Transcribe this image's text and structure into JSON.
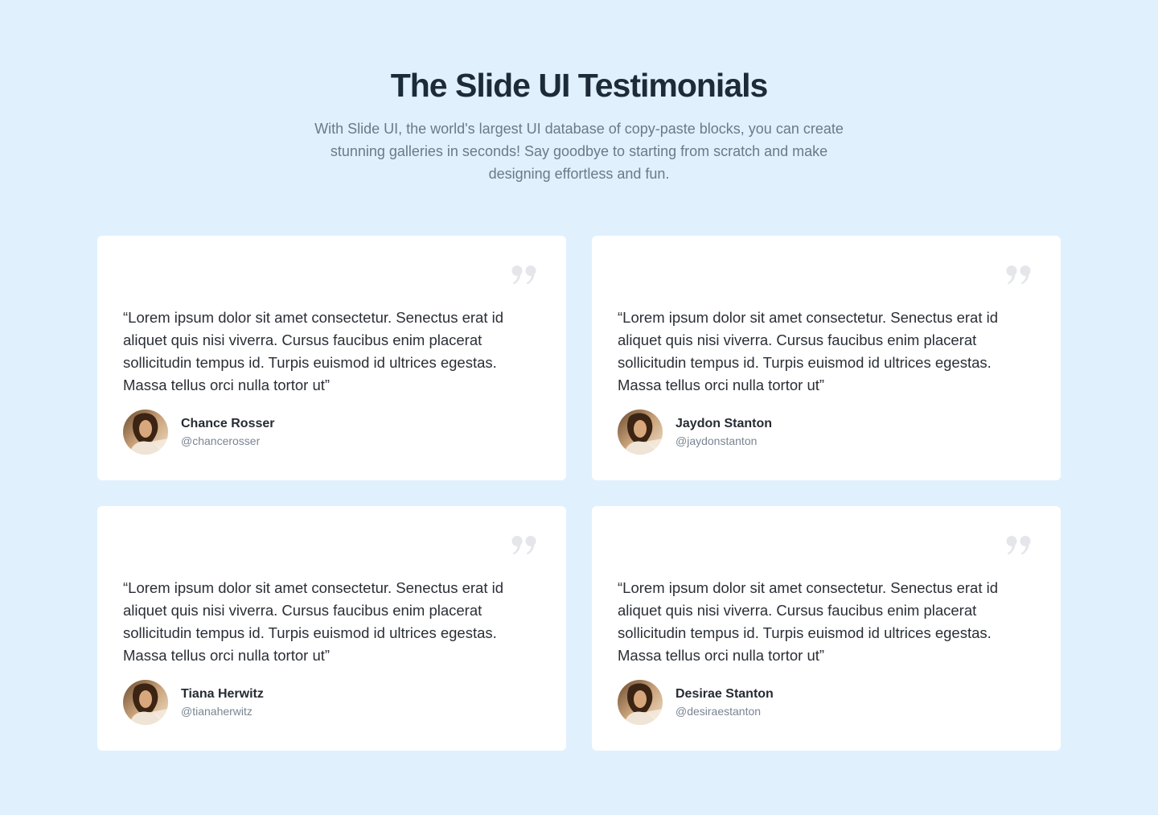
{
  "header": {
    "title": "The Slide UI Testimonials",
    "subtitle": "With Slide UI, the world's largest UI database of copy-paste blocks, you can create stunning galleries in seconds! Say goodbye to starting from scratch and make designing effortless and fun."
  },
  "colors": {
    "background": "#e1f0fd",
    "card": "#ffffff",
    "quote_icon": "#e5e7eb"
  },
  "testimonials": [
    {
      "quote": "“Lorem ipsum dolor sit amet consectetur. Senectus erat id aliquet quis nisi viverra. Cursus faucibus enim placerat sollicitudin tempus id. Turpis euismod id ultrices egestas. Massa tellus orci nulla tortor ut”",
      "name": "Chance Rosser",
      "handle": "@chancerosser",
      "icon": "quote-icon"
    },
    {
      "quote": "“Lorem ipsum dolor sit amet consectetur. Senectus erat id aliquet quis nisi viverra. Cursus faucibus enim placerat sollicitudin tempus id. Turpis euismod id ultrices egestas. Massa tellus orci nulla tortor ut”",
      "name": "Jaydon Stanton",
      "handle": "@jaydonstanton",
      "icon": "quote-icon"
    },
    {
      "quote": "“Lorem ipsum dolor sit amet consectetur. Senectus erat id aliquet quis nisi viverra. Cursus faucibus enim placerat sollicitudin tempus id. Turpis euismod id ultrices egestas. Massa tellus orci nulla tortor ut”",
      "name": "Tiana Herwitz",
      "handle": "@tianaherwitz",
      "icon": "quote-icon"
    },
    {
      "quote": "“Lorem ipsum dolor sit amet consectetur. Senectus erat id aliquet quis nisi viverra. Cursus faucibus enim placerat sollicitudin tempus id. Turpis euismod id ultrices egestas. Massa tellus orci nulla tortor ut”",
      "name": "Desirae Stanton",
      "handle": "@desiraestanton",
      "icon": "quote-icon"
    }
  ]
}
